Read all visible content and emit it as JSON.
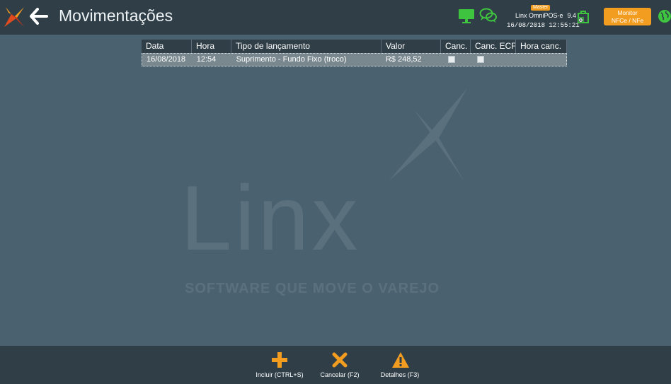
{
  "header": {
    "title": "Movimentações",
    "badge": "Master",
    "product_name": "Linx OmniPOS-e",
    "version": "9.4",
    "datetime": "16/08/2018 12:55:21",
    "monitor_line1": "Monitor",
    "monitor_line2": "NFCe / NFe"
  },
  "watermark": {
    "word": "Linx",
    "slogan": "SOFTWARE QUE MOVE O VAREJO"
  },
  "table": {
    "columns": [
      "Data",
      "Hora",
      "Tipo de lançamento",
      "Valor",
      "Canc.",
      "Canc. ECF",
      "Hora canc."
    ],
    "rows": [
      {
        "data": "16/08/2018",
        "hora": "12:54",
        "tipo": "Suprimento - Fundo Fixo (troco)",
        "valor": "R$ 248,52",
        "canc": false,
        "canc_ecf": false,
        "hora_canc": ""
      }
    ]
  },
  "footer": {
    "incluir": "Incluir (CTRL+S)",
    "cancelar": "Cancelar (F2)",
    "detalhes": "Detalhes (F3)"
  },
  "colors": {
    "accent": "#f29d1f",
    "status_green": "#3ec43e",
    "bar": "#2f3e47",
    "background": "#4a6270"
  },
  "icons": [
    "linx-logo-icon",
    "back-arrow-icon",
    "monitor-icon",
    "chat-icon",
    "shopping-bag-icon",
    "globe-icon",
    "plus-icon",
    "x-icon",
    "warning-icon"
  ]
}
